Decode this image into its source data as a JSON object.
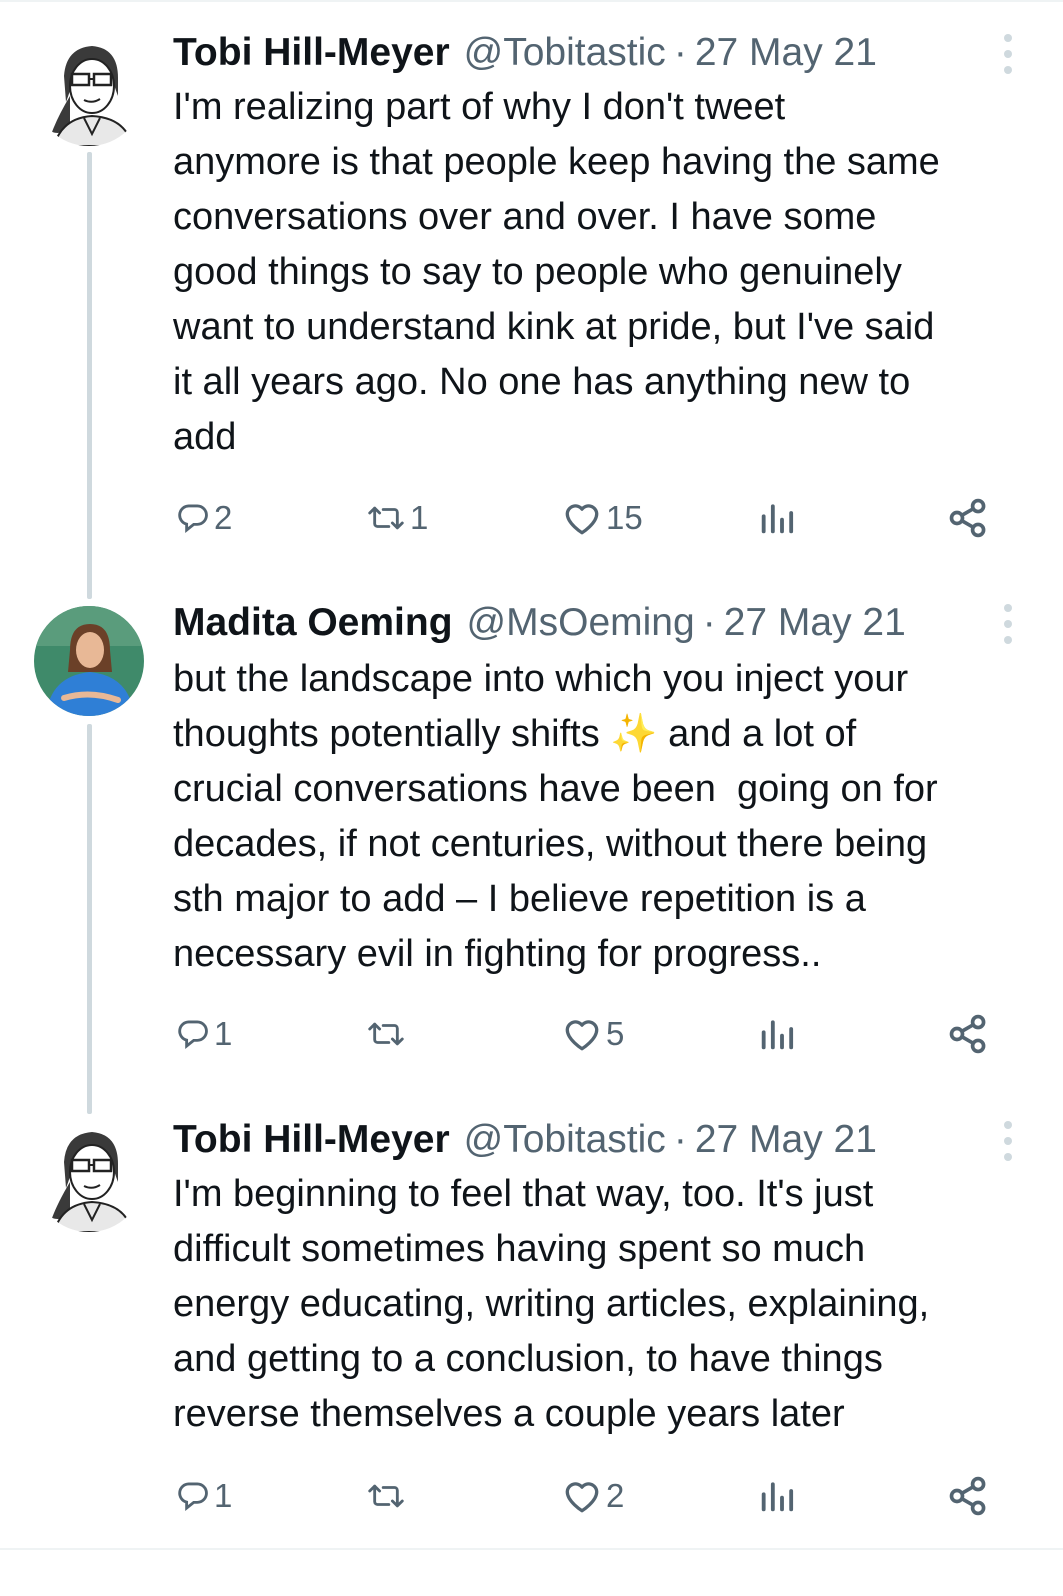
{
  "tweets": [
    {
      "name": "Tobi Hill-Meyer",
      "handle": "@Tobitastic",
      "separator": "·",
      "date": "27 May 21",
      "text": "I'm realizing part of why I don't tweet\nanymore is that people keep having the same\nconversations over and over. I have some\ngood things to say to people who genuinely\nwant to understand kink at pride, but I've said\nit all years ago. No one has anything new to\nadd",
      "replies": "2",
      "retweets": "1",
      "likes": "15"
    },
    {
      "name": "Madita Oeming",
      "handle": "@MsOeming",
      "separator": "·",
      "date": "27 May 21",
      "text": "but the landscape into which you inject your\nthoughts potentially shifts ✨ and a lot of\ncrucial conversations have been  going on for\ndecades, if not centuries, without there being\nsth major to add – I believe repetition is a\nnecessary evil in fighting for progress..",
      "replies": "1",
      "retweets": "",
      "likes": "5"
    },
    {
      "name": "Tobi Hill-Meyer",
      "handle": "@Tobitastic",
      "separator": "·",
      "date": "27 May 21",
      "text": "I'm beginning to feel that way, too. It's just\ndifficult sometimes having spent so much\nenergy educating, writing articles, explaining,\nand getting to a conclusion, to have things\nreverse themselves a couple years later",
      "replies": "1",
      "retweets": "",
      "likes": "2"
    }
  ],
  "icons": {
    "reply": "reply-icon",
    "retweet": "retweet-icon",
    "like": "heart-icon",
    "views": "views-icon",
    "share": "share-icon",
    "more": "more-icon"
  },
  "colors": {
    "text": "#0f1419",
    "secondary": "#536471",
    "thread_line": "#cfd9de",
    "madita_shirt": "#2f7fd6",
    "madita_background": "#3f8a6a"
  }
}
